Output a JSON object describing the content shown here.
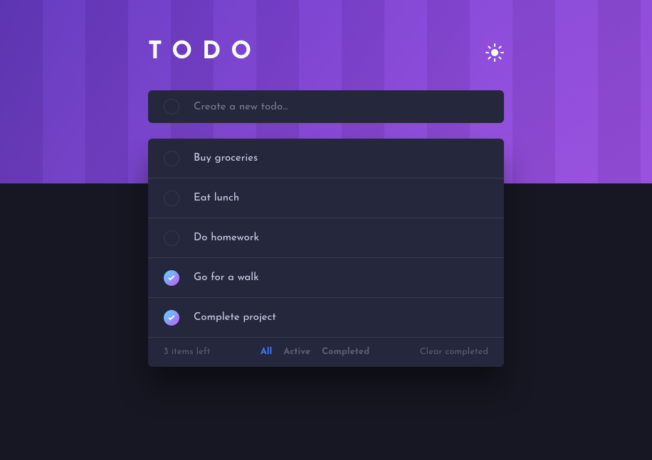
{
  "header": {
    "title": "TODO"
  },
  "input": {
    "placeholder": "Create a new todo..."
  },
  "todos": [
    {
      "text": "Buy groceries",
      "completed": false
    },
    {
      "text": "Eat lunch",
      "completed": false
    },
    {
      "text": "Do homework",
      "completed": false
    },
    {
      "text": "Go for a walk",
      "completed": true
    },
    {
      "text": "Complete project",
      "completed": true
    }
  ],
  "footer": {
    "items_left": "3 items left",
    "filters": {
      "all": "All",
      "active": "Active",
      "completed": "Completed"
    },
    "clear": "Clear completed"
  }
}
